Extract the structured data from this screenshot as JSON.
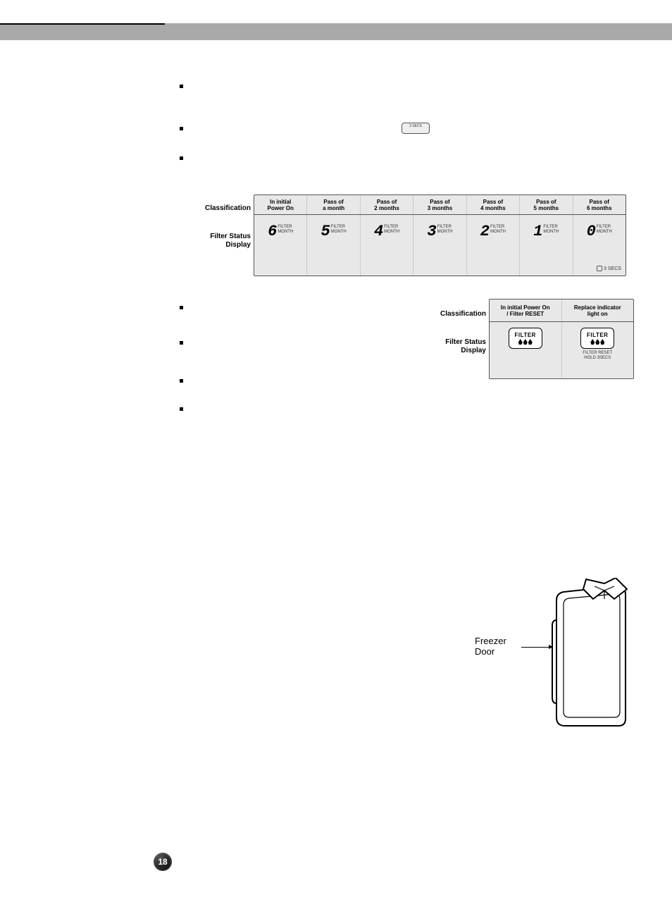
{
  "page_number": "18",
  "mini_badge": "3 SECS",
  "labels": {
    "classification": "Classification",
    "filter_status_display_l1": "Filter Status",
    "filter_status_display_l2": "Display"
  },
  "table1": {
    "headers": [
      {
        "l1": "In initial",
        "l2": "Power On"
      },
      {
        "l1": "Pass of",
        "l2": "a month"
      },
      {
        "l1": "Pass of",
        "l2": "2 months"
      },
      {
        "l1": "Pass of",
        "l2": "3 months"
      },
      {
        "l1": "Pass of",
        "l2": "4 months"
      },
      {
        "l1": "Pass of",
        "l2": "5 months"
      },
      {
        "l1": "Pass of",
        "l2": "6 months"
      }
    ],
    "cells": [
      {
        "digit": "6",
        "l1": "FILTER",
        "l2": "MONTH"
      },
      {
        "digit": "5",
        "l1": "FILTER",
        "l2": "MONTH"
      },
      {
        "digit": "4",
        "l1": "FILTER",
        "l2": "MONTH"
      },
      {
        "digit": "3",
        "l1": "FILTER",
        "l2": "MONTH"
      },
      {
        "digit": "2",
        "l1": "FILTER",
        "l2": "MONTH"
      },
      {
        "digit": "1",
        "l1": "FILTER",
        "l2": "MONTH"
      },
      {
        "digit": "0",
        "l1": "FILTER",
        "l2": "MONTH"
      }
    ],
    "reset_hint": "3 SECS"
  },
  "table2": {
    "headers": [
      {
        "l1": "In initial Power On",
        "l2": "/ Filter RESET"
      },
      {
        "l1": "Replace indicator",
        "l2": "light on"
      }
    ],
    "filter_text": "FILTER",
    "sub_reset_l1": "FILTER RESET",
    "sub_reset_l2": "HOLD 3SECS"
  },
  "figure": {
    "label_l1": "Freezer",
    "label_l2": "Door"
  }
}
